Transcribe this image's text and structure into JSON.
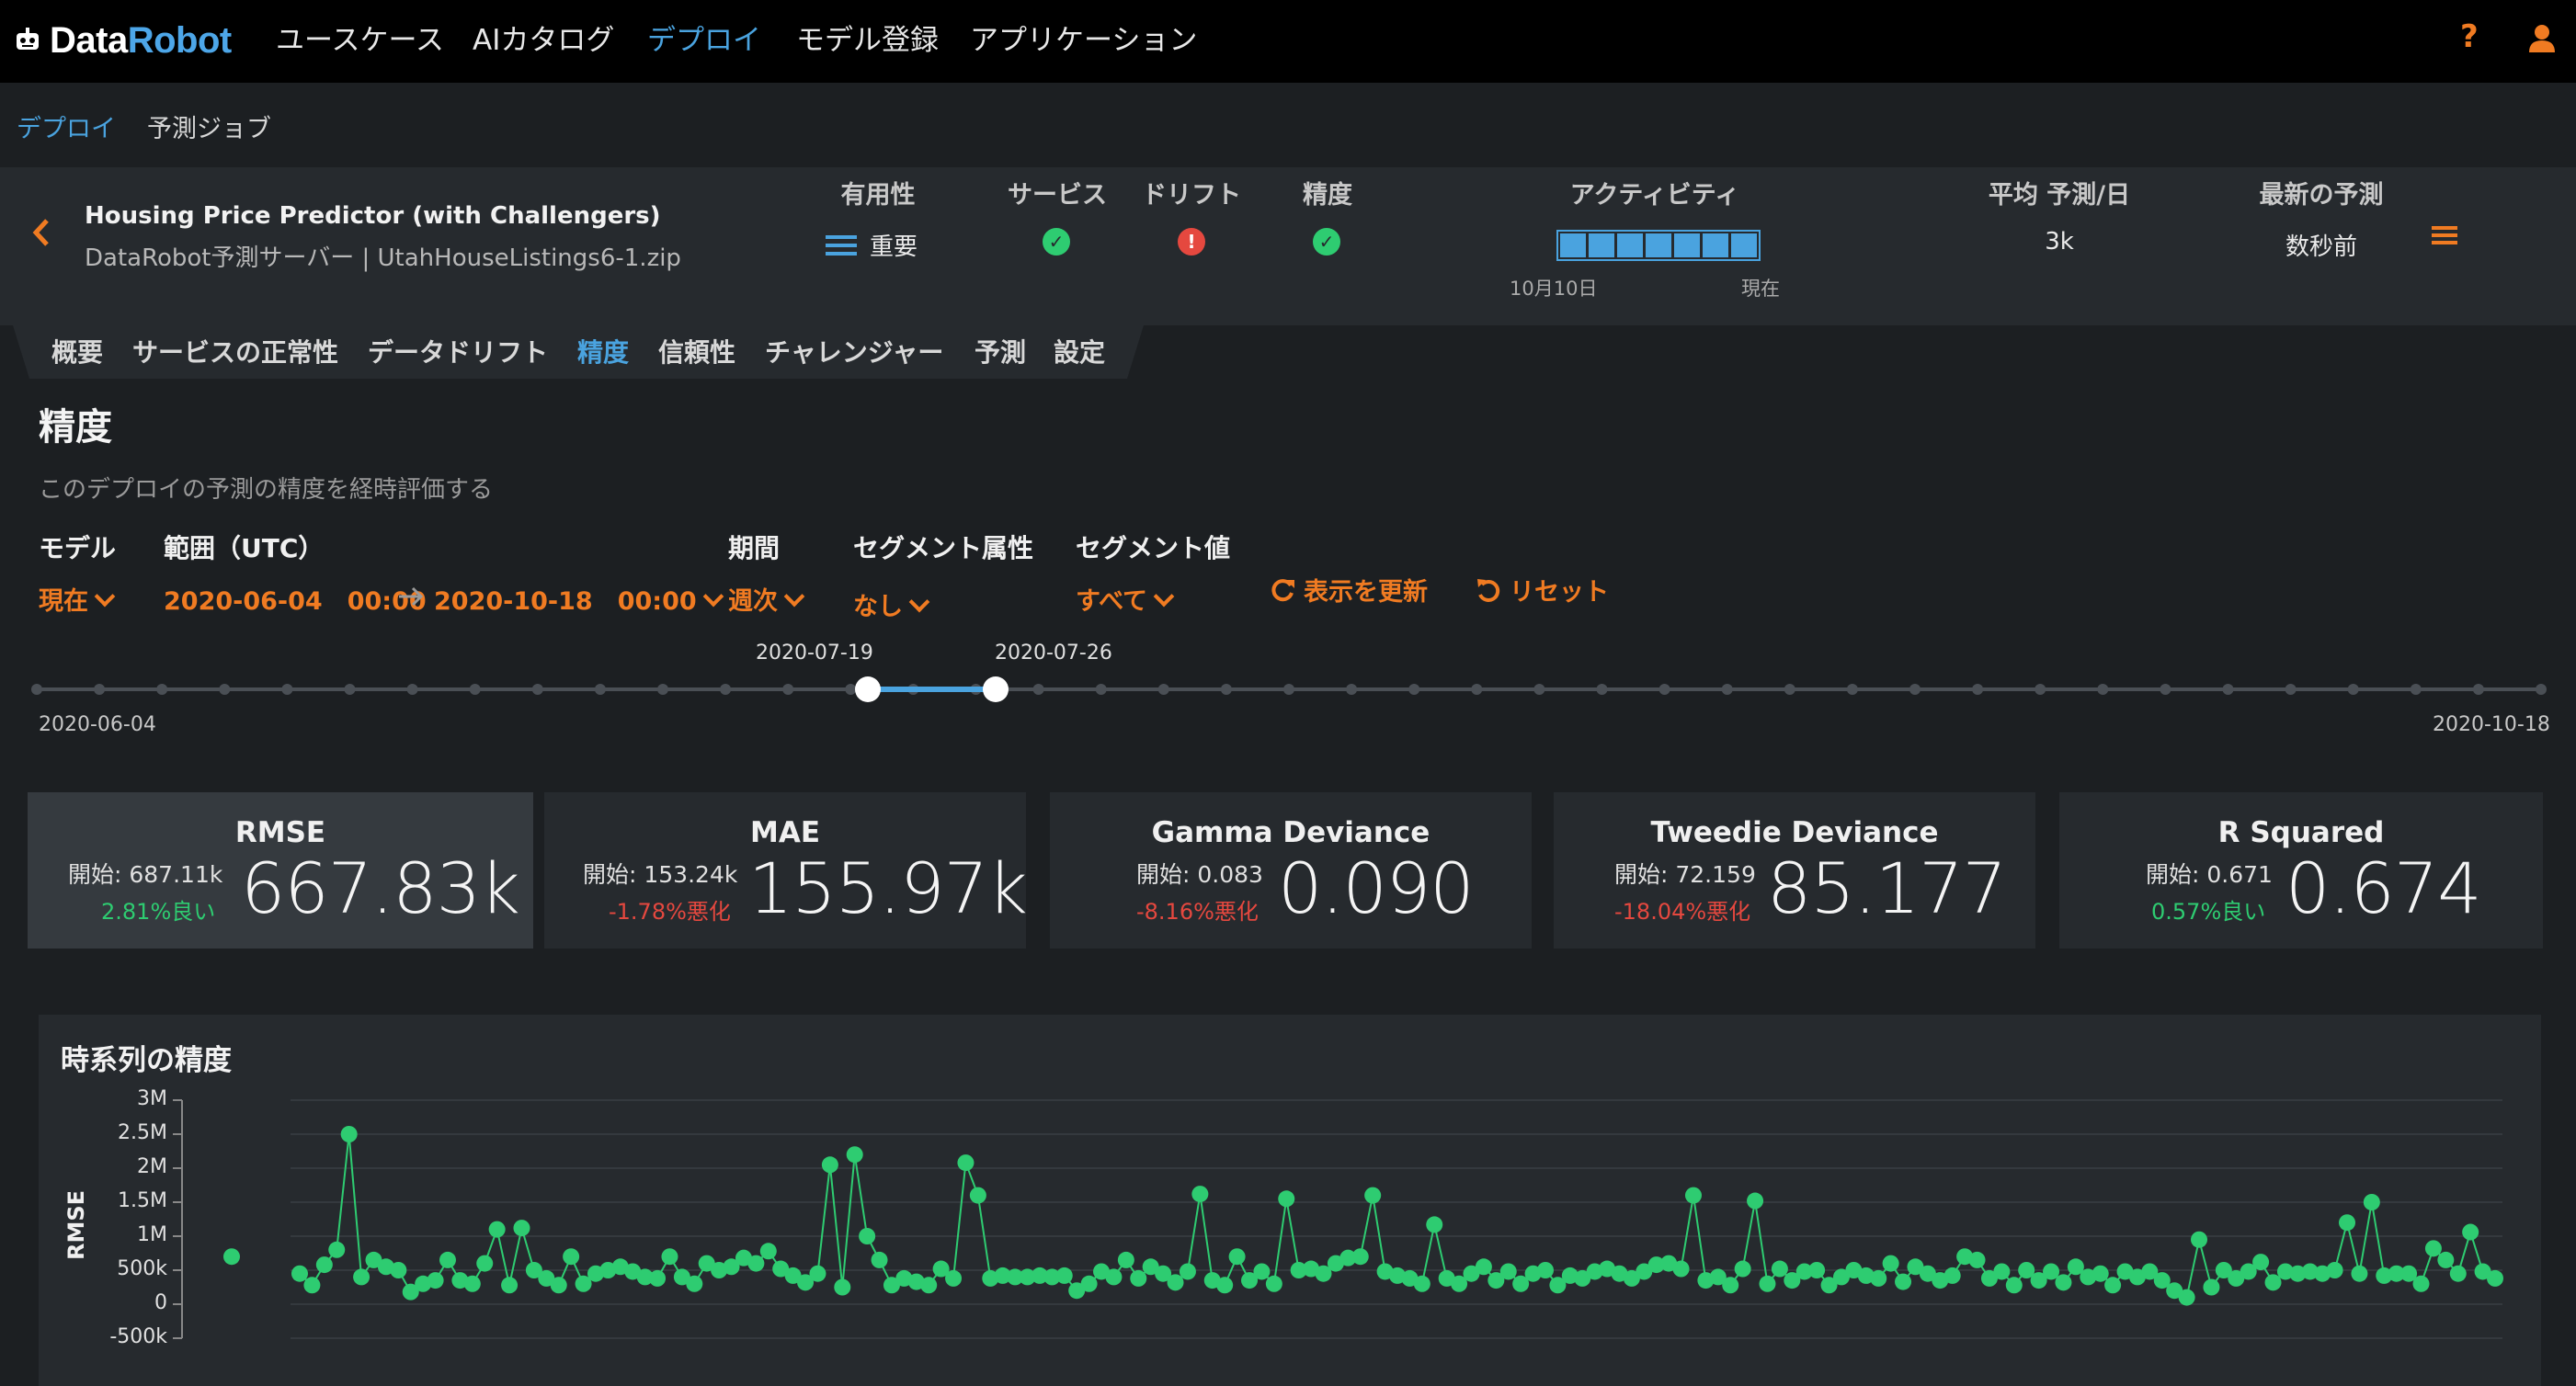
{
  "app": {
    "logo_part1": "Data",
    "logo_part2": "Robot",
    "nav": [
      "ユースケース",
      "AIカタログ",
      "デプロイ",
      "モデル登録",
      "アプリケーション"
    ],
    "nav_active": "デプロイ",
    "help_icon": "?",
    "accent": "#f07b22",
    "link_color": "#4aa3df"
  },
  "breadcrumb": {
    "item1": "デプロイ",
    "item2": "予測ジョブ"
  },
  "deployment": {
    "name": "Housing Price Predictor (with Challengers)",
    "subtitle": "DataRobot予測サーバー | UtahHouseListings6-1.zip",
    "importance_label": "有用性",
    "importance_value": "重要",
    "service_label": "サービス",
    "drift_label": "ドリフト",
    "accuracy_label": "精度",
    "activity_label": "アクティビティ",
    "activity_start": "10月10日",
    "activity_end": "現在",
    "avg_label": "平均 予測/日",
    "avg_value": "3k",
    "latest_label": "最新の予測",
    "latest_value": "数秒前",
    "status": {
      "service": "ok",
      "drift": "error",
      "accuracy": "ok"
    }
  },
  "tabs": [
    "概要",
    "サービスの正常性",
    "データドリフト",
    "精度",
    "信頼性",
    "チャレンジャー",
    "予測",
    "設定"
  ],
  "active_tab": "精度",
  "page": {
    "title": "精度",
    "description": "このデプロイの予測の精度を経時評価する"
  },
  "filters": {
    "model_label": "モデル",
    "model_value": "現在",
    "range_label": "範囲（UTC）",
    "range_start": "2020-06-04　00:00",
    "range_end": "2020-10-18　00:00",
    "period_label": "期間",
    "period_value": "週次",
    "segattr_label": "セグメント属性",
    "segattr_value": "なし",
    "segval_label": "セグメント値",
    "segval_value": "すべて",
    "refresh": "表示を更新",
    "reset": "リセット"
  },
  "timeline": {
    "start": "2020-06-04",
    "end": "2020-10-18",
    "sel_start": "2020-07-19",
    "sel_end": "2020-07-26"
  },
  "metrics": [
    {
      "name": "RMSE",
      "start": "開始: 687.11k",
      "change": "2.81%良い",
      "trend": "good",
      "value": "667.83k"
    },
    {
      "name": "MAE",
      "start": "開始: 153.24k",
      "change": "-1.78%悪化",
      "trend": "bad",
      "value": "155.97k"
    },
    {
      "name": "Gamma Deviance",
      "start": "開始: 0.083",
      "change": "-8.16%悪化",
      "trend": "bad",
      "value": "0.090"
    },
    {
      "name": "Tweedie Deviance",
      "start": "開始: 72.159",
      "change": "-18.04%悪化",
      "trend": "bad",
      "value": "85.177"
    },
    {
      "name": "R Squared",
      "start": "開始: 0.671",
      "change": "0.57%良い",
      "trend": "good",
      "value": "0.674"
    }
  ],
  "chart_title": "時系列の精度",
  "chart_data": {
    "type": "line",
    "ylabel": "RMSE",
    "yticks": [
      "3M",
      "2.5M",
      "2M",
      "1.5M",
      "1M",
      "500k",
      "0",
      "-500k"
    ],
    "ylim": [
      -500000,
      3000000
    ],
    "series_color": "#2ecc71",
    "isolated_point": 700000,
    "values": [
      450000,
      280000,
      580000,
      800000,
      2500000,
      400000,
      650000,
      550000,
      500000,
      180000,
      300000,
      350000,
      650000,
      350000,
      300000,
      600000,
      1100000,
      280000,
      1120000,
      500000,
      380000,
      280000,
      700000,
      300000,
      450000,
      500000,
      550000,
      480000,
      400000,
      380000,
      700000,
      400000,
      300000,
      600000,
      500000,
      550000,
      680000,
      600000,
      780000,
      520000,
      420000,
      320000,
      450000,
      2050000,
      250000,
      2200000,
      1000000,
      650000,
      280000,
      380000,
      330000,
      280000,
      520000,
      380000,
      2080000,
      1600000,
      380000,
      420000,
      400000,
      400000,
      420000,
      400000,
      420000,
      200000,
      300000,
      480000,
      400000,
      650000,
      380000,
      550000,
      450000,
      320000,
      480000,
      1620000,
      350000,
      280000,
      700000,
      350000,
      480000,
      300000,
      1550000,
      500000,
      520000,
      450000,
      600000,
      680000,
      700000,
      1600000,
      480000,
      420000,
      380000,
      300000,
      1170000,
      380000,
      300000,
      450000,
      550000,
      350000,
      480000,
      300000,
      450000,
      500000,
      280000,
      420000,
      380000,
      480000,
      520000,
      450000,
      380000,
      480000,
      580000,
      600000,
      520000,
      1600000,
      350000,
      400000,
      280000,
      520000,
      1520000,
      300000,
      520000,
      350000,
      480000,
      500000,
      280000,
      400000,
      500000,
      420000,
      380000,
      600000,
      330000,
      550000,
      450000,
      350000,
      420000,
      700000,
      650000,
      380000,
      480000,
      280000,
      500000,
      350000,
      480000,
      320000,
      550000,
      400000,
      450000,
      280000,
      480000,
      400000,
      480000,
      350000,
      200000,
      100000,
      950000,
      250000,
      500000,
      380000,
      480000,
      620000,
      320000,
      480000,
      450000,
      480000,
      450000,
      500000,
      1200000,
      450000,
      1500000,
      420000,
      450000,
      450000,
      300000,
      820000,
      650000,
      450000,
      1060000,
      480000,
      380000
    ]
  }
}
